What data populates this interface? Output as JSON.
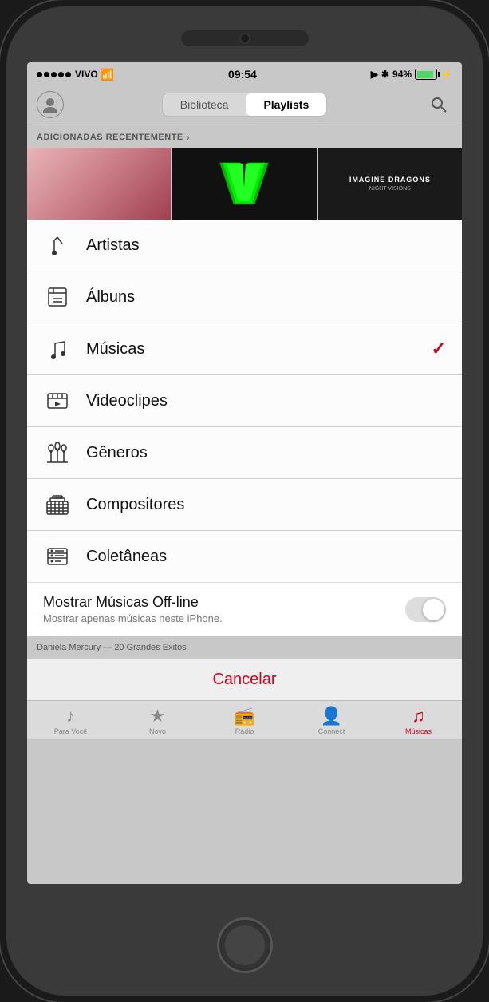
{
  "status_bar": {
    "carrier": "VIVO",
    "wifi_symbol": "📶",
    "time": "09:54",
    "location_arrow": "➤",
    "bluetooth": "✱",
    "battery_percent": "94%"
  },
  "header": {
    "tab_biblioteca": "Biblioteca",
    "tab_playlists": "Playlists"
  },
  "recently_added": {
    "label": "ADICIONADAS RECENTEMENTE",
    "chevron": "›"
  },
  "menu_items": [
    {
      "id": "artistas",
      "icon": "🎤",
      "label": "Artistas",
      "checked": false
    },
    {
      "id": "albuns",
      "icon": "🎵",
      "label": "Álbuns",
      "checked": false
    },
    {
      "id": "musicas",
      "icon": "♪",
      "label": "Músicas",
      "checked": true
    },
    {
      "id": "videoclipes",
      "icon": "📹",
      "label": "Videoclipes",
      "checked": false
    },
    {
      "id": "generos",
      "icon": "🎸",
      "label": "Gêneros",
      "checked": false
    },
    {
      "id": "compositores",
      "icon": "🎹",
      "label": "Compositores",
      "checked": false
    },
    {
      "id": "coletaneas",
      "icon": "📚",
      "label": "Coletâneas",
      "checked": false
    }
  ],
  "offline_toggle": {
    "title": "Mostrar Músicas Off-line",
    "subtitle": "Mostrar apenas músicas neste iPhone.",
    "enabled": false
  },
  "bottom_peek": {
    "text": "Daniela Mercury — 20 Grandes Exitos"
  },
  "cancel": {
    "label": "Cancelar"
  },
  "bottom_nav": [
    {
      "id": "para-voce",
      "icon": "♪",
      "label": "Para Você"
    },
    {
      "id": "novo",
      "icon": "★",
      "label": "Novo"
    },
    {
      "id": "radio",
      "icon": "📻",
      "label": "Rádio"
    },
    {
      "id": "connect",
      "icon": "👤",
      "label": "Connect"
    },
    {
      "id": "musicas",
      "icon": "♫",
      "label": "Músicas"
    }
  ]
}
